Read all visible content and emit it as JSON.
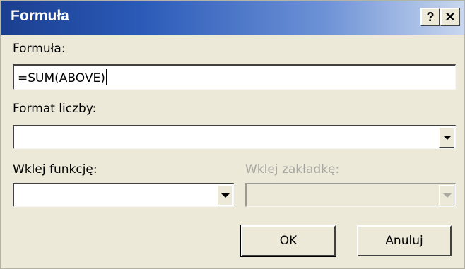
{
  "window": {
    "title": "Formuła",
    "help_label": "?",
    "close_label": "✕"
  },
  "formula": {
    "label": "Formuła:",
    "value": "=SUM(ABOVE)"
  },
  "number_format": {
    "label": "Format liczby:",
    "value": ""
  },
  "paste_function": {
    "label": "Wklej funkcję:",
    "value": ""
  },
  "paste_bookmark": {
    "label": "Wklej zakładkę:",
    "value": "",
    "enabled": false
  },
  "buttons": {
    "ok": "OK",
    "cancel": "Anuluj"
  },
  "colors": {
    "titlebar_start": "#1b3f8f",
    "titlebar_end": "#c9d7ef",
    "dialog_bg": "#ece9d8",
    "disabled_text": "#a7a6a0"
  }
}
